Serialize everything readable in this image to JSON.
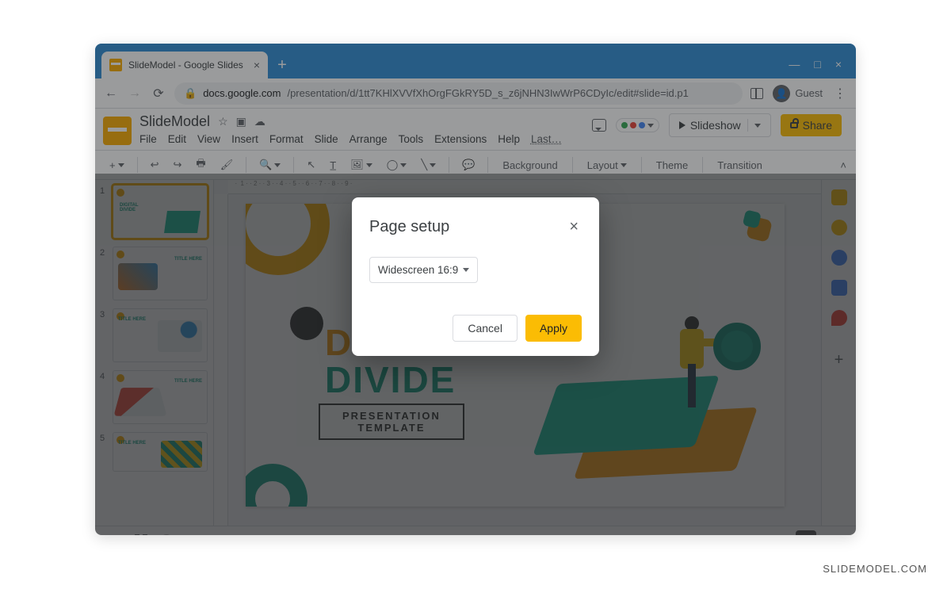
{
  "browser": {
    "tab_title": "SlideModel - Google Slides",
    "url_host": "docs.google.com",
    "url_path": "/presentation/d/1tt7KHlXVVfXhOrgFGkRY5D_s_z6jNHN3IwWrP6CDyIc/edit#slide=id.p1",
    "guest_label": "Guest"
  },
  "doc": {
    "title": "SlideModel",
    "menus": [
      "File",
      "Edit",
      "View",
      "Insert",
      "Format",
      "Slide",
      "Arrange",
      "Tools",
      "Extensions",
      "Help"
    ],
    "last_edit": "Last…",
    "slideshow_label": "Slideshow",
    "share_label": "Share"
  },
  "toolbar": {
    "background": "Background",
    "layout": "Layout",
    "theme": "Theme",
    "transition": "Transition"
  },
  "slide": {
    "title_line1": "DIGITAL",
    "title_line2": "DIVIDE",
    "subtitle_l1": "PRESENTATION",
    "subtitle_l2": "TEMPLATE"
  },
  "thumbs": {
    "t1": "DIGITAL\nDIVIDE",
    "generic": "TITLE HERE"
  },
  "dialog": {
    "title": "Page setup",
    "selected": "Widescreen 16:9",
    "cancel": "Cancel",
    "apply": "Apply"
  },
  "watermark": "SLIDEMODEL.COM"
}
